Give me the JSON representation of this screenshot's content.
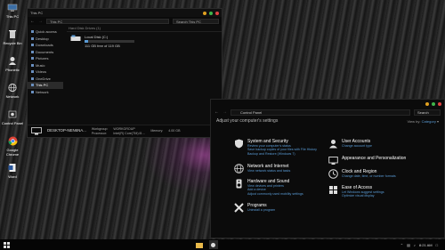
{
  "desktop": {
    "icons": [
      {
        "label": "This PC"
      },
      {
        "label": "Recycle Bin"
      },
      {
        "label": "Phonetic"
      },
      {
        "label": "Network"
      },
      {
        "label": "Control Panel"
      },
      {
        "label": "Google Chrome"
      },
      {
        "label": "Word"
      }
    ]
  },
  "explorer": {
    "title": "This PC",
    "address": "This PC",
    "search_placeholder": "Search This PC",
    "section_label": "Hard Disk Drives (1)",
    "drive_name": "Local Disk (C:)",
    "drive_space": "111 GB free of 119 GB",
    "drive_used_fraction": 0.07,
    "nav_items": [
      {
        "label": "Quick access"
      },
      {
        "label": "Desktop"
      },
      {
        "label": "Downloads"
      },
      {
        "label": "Documents"
      },
      {
        "label": "Pictures"
      },
      {
        "label": "Music"
      },
      {
        "label": "Videos"
      },
      {
        "label": "OneDrive"
      },
      {
        "label": "This PC"
      },
      {
        "label": "Network"
      }
    ],
    "pc_name": "DESKTOP-NEN6NA...",
    "workgroup_label": "Workgroup:",
    "workgroup_value": "WORKGROUP",
    "processor_label": "Processor:",
    "processor_value": "Intel(R) Core(TM) i5 ...",
    "memory_label": "Memory:",
    "memory_value": "4.00 GB"
  },
  "control_panel": {
    "address": "Control Panel",
    "search_placeholder": "Search",
    "heading": "Adjust your computer's settings",
    "view_by_label": "View by:",
    "view_by_value": "Category",
    "categories": [
      {
        "title": "System and Security",
        "lines": [
          "Review your computer's status",
          "Save backup copies of your files with File History",
          "Backup and Restore (Windows 7)"
        ]
      },
      {
        "title": "Network and Internet",
        "lines": [
          "View network status and tasks"
        ]
      },
      {
        "title": "Hardware and Sound",
        "lines": [
          "View devices and printers",
          "Add a device",
          "Adjust commonly used mobility settings"
        ]
      },
      {
        "title": "Programs",
        "lines": [
          "Uninstall a program"
        ]
      },
      {
        "title": "User Accounts",
        "lines": [
          "Change account type"
        ]
      },
      {
        "title": "Appearance and Personalization",
        "lines": []
      },
      {
        "title": "Clock and Region",
        "lines": [
          "Change date, time, or number formats"
        ]
      },
      {
        "title": "Ease of Access",
        "lines": [
          "Let Windows suggest settings",
          "Optimize visual display"
        ]
      }
    ]
  },
  "taskbar": {
    "time": "8:21 AM"
  },
  "colors": {
    "accent": "#5a9bd5",
    "close": "#e04343",
    "maximize": "#3fb64b",
    "minimize": "#e0a020"
  }
}
